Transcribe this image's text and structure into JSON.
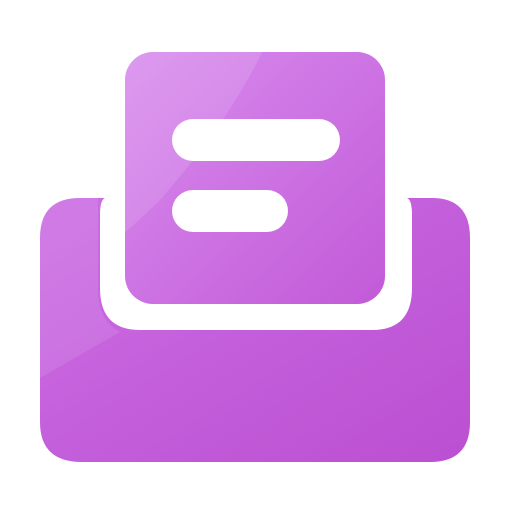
{
  "icon": {
    "name": "inbox-document-icon",
    "colors": {
      "tray_fill": "#c04fd4",
      "document_fill": "#cf6fe4",
      "document_highlight": "#dd95ef",
      "stroke_white": "#ffffff",
      "text_bar": "#ffffff",
      "background": "#ffffff"
    }
  }
}
